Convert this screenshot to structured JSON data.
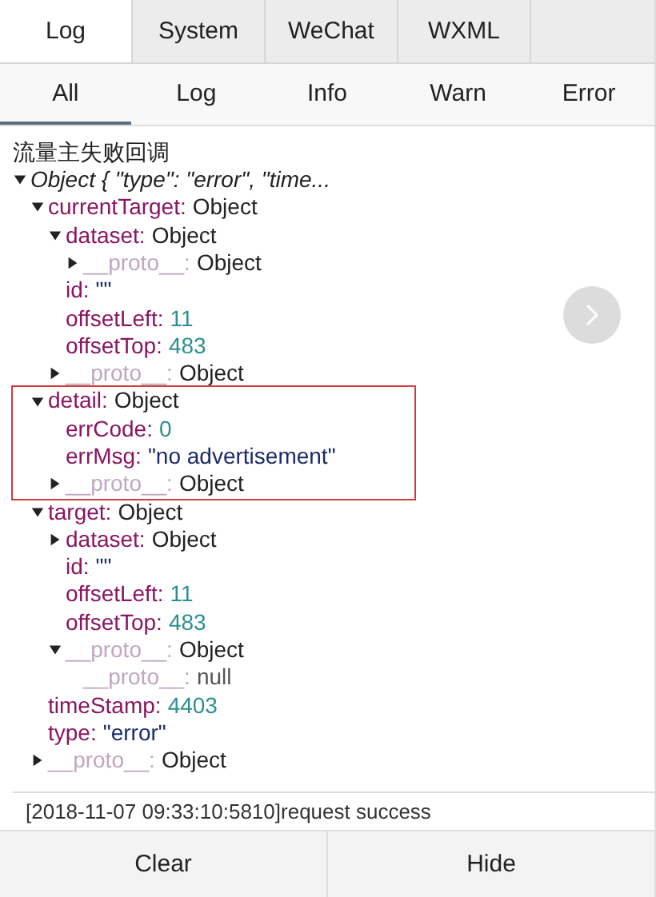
{
  "tabs": [
    {
      "label": "Log",
      "selected": true
    },
    {
      "label": "System",
      "selected": false
    },
    {
      "label": "WeChat",
      "selected": false
    },
    {
      "label": "WXML",
      "selected": false
    }
  ],
  "filters": [
    {
      "label": "All",
      "selected": true
    },
    {
      "label": "Log",
      "selected": false
    },
    {
      "label": "Info",
      "selected": false
    },
    {
      "label": "Warn",
      "selected": false
    },
    {
      "label": "Error",
      "selected": false
    }
  ],
  "entry": {
    "message": "流量主失败回调",
    "summary": "Object { \"type\": \"error\", \"time...",
    "expanded": true,
    "children": [
      {
        "key": "currentTarget:",
        "value": "Object",
        "kind": "object",
        "dim": false,
        "expanded": true,
        "children": [
          {
            "key": "dataset:",
            "value": "Object",
            "kind": "object",
            "dim": false,
            "expanded": true,
            "children": [
              {
                "key": "__proto__:",
                "value": "Object",
                "kind": "object",
                "dim": true,
                "expanded": false
              }
            ]
          },
          {
            "key": "id:",
            "value": "\"\"",
            "kind": "string",
            "dim": false
          },
          {
            "key": "offsetLeft:",
            "value": "11",
            "kind": "number",
            "dim": false
          },
          {
            "key": "offsetTop:",
            "value": "483",
            "kind": "number",
            "dim": false
          },
          {
            "key": "__proto__:",
            "value": "Object",
            "kind": "object",
            "dim": true,
            "expanded": false
          }
        ]
      },
      {
        "key": "detail:",
        "value": "Object",
        "kind": "object",
        "dim": false,
        "expanded": true,
        "highlighted": true,
        "children": [
          {
            "key": "errCode:",
            "value": "0",
            "kind": "number",
            "dim": false
          },
          {
            "key": "errMsg:",
            "value": "\"no advertisement\"",
            "kind": "string",
            "dim": false
          },
          {
            "key": "__proto__:",
            "value": "Object",
            "kind": "object",
            "dim": true,
            "expanded": false
          }
        ]
      },
      {
        "key": "target:",
        "value": "Object",
        "kind": "object",
        "dim": false,
        "expanded": true,
        "children": [
          {
            "key": "dataset:",
            "value": "Object",
            "kind": "object",
            "dim": false,
            "expanded": false
          },
          {
            "key": "id:",
            "value": "\"\"",
            "kind": "string",
            "dim": false
          },
          {
            "key": "offsetLeft:",
            "value": "11",
            "kind": "number",
            "dim": false
          },
          {
            "key": "offsetTop:",
            "value": "483",
            "kind": "number",
            "dim": false
          },
          {
            "key": "__proto__:",
            "value": "Object",
            "kind": "object",
            "dim": true,
            "expanded": true,
            "children": [
              {
                "key": "__proto__:",
                "value": "null",
                "kind": "null",
                "dim": true
              }
            ]
          }
        ]
      },
      {
        "key": "timeStamp:",
        "value": "4403",
        "kind": "number",
        "dim": false
      },
      {
        "key": "type:",
        "value": "\"error\"",
        "kind": "string",
        "dim": false
      },
      {
        "key": "__proto__:",
        "value": "Object",
        "kind": "object",
        "dim": true,
        "expanded": false
      }
    ]
  },
  "next_log": "[2018-11-07 09:33:10:5810]request success",
  "buttons": [
    "Clear",
    "Hide"
  ]
}
